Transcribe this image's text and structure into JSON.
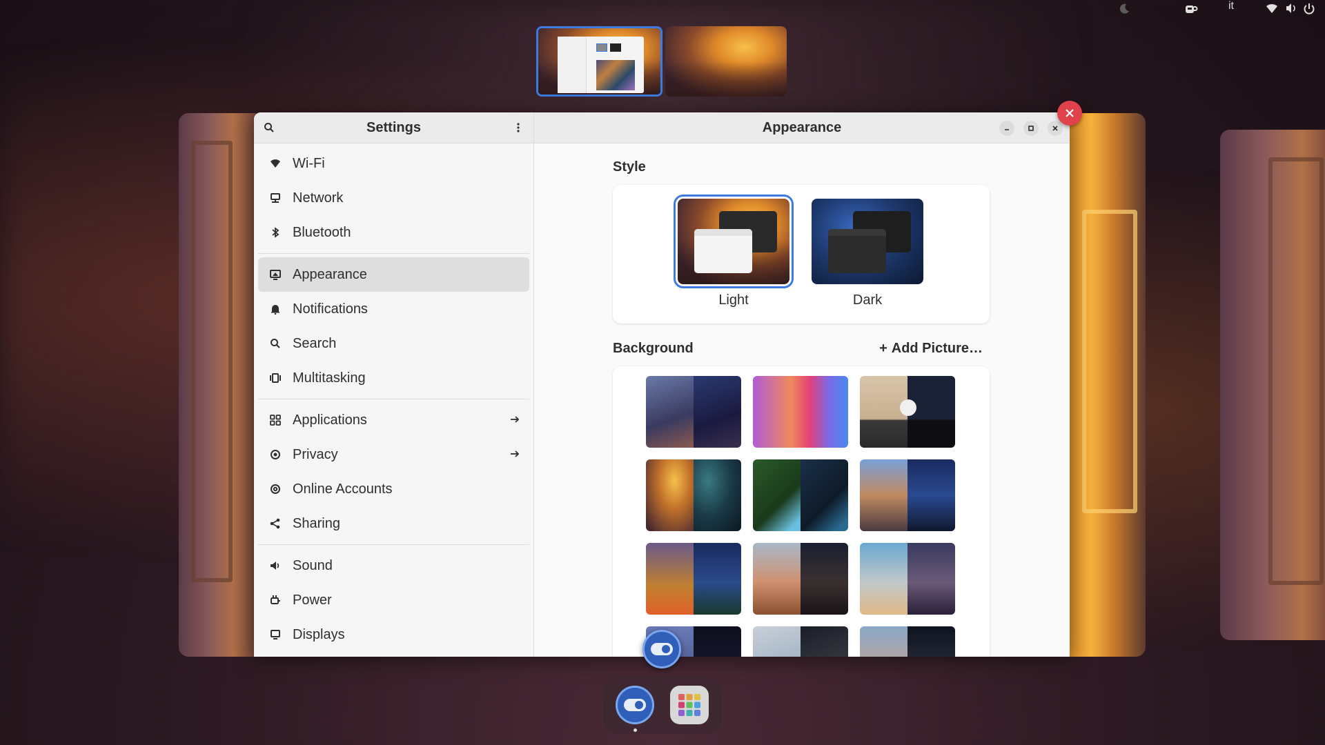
{
  "topbar": {
    "keyboard_layout": "it",
    "icons": [
      "moon-icon",
      "coffee-icon",
      "wifi-icon",
      "volume-icon",
      "power-icon"
    ]
  },
  "workspaces": [
    {
      "label": "workspace-1",
      "active": true
    },
    {
      "label": "workspace-2",
      "active": false
    }
  ],
  "sidebar": {
    "title": "Settings",
    "items": [
      {
        "label": "Wi-Fi",
        "icon": "wifi-icon"
      },
      {
        "label": "Network",
        "icon": "network-icon"
      },
      {
        "label": "Bluetooth",
        "icon": "bluetooth-icon"
      },
      {
        "label": "Appearance",
        "icon": "appearance-icon",
        "selected": true
      },
      {
        "label": "Notifications",
        "icon": "bell-icon"
      },
      {
        "label": "Search",
        "icon": "search-icon"
      },
      {
        "label": "Multitasking",
        "icon": "multitasking-icon"
      },
      {
        "label": "Applications",
        "icon": "apps-grid-icon",
        "arrow": true
      },
      {
        "label": "Privacy",
        "icon": "privacy-icon",
        "arrow": true
      },
      {
        "label": "Online Accounts",
        "icon": "at-icon"
      },
      {
        "label": "Sharing",
        "icon": "share-icon"
      },
      {
        "label": "Sound",
        "icon": "speaker-icon"
      },
      {
        "label": "Power",
        "icon": "power-plug-icon"
      },
      {
        "label": "Displays",
        "icon": "display-icon"
      }
    ]
  },
  "content": {
    "title": "Appearance",
    "style_section": "Style",
    "style_options": [
      {
        "label": "Light",
        "selected": true
      },
      {
        "label": "Dark",
        "selected": false
      }
    ],
    "background_section": "Background",
    "add_picture": "Add Picture…"
  },
  "colors": {
    "accent": "#3c7be0",
    "close": "#e0414a"
  }
}
